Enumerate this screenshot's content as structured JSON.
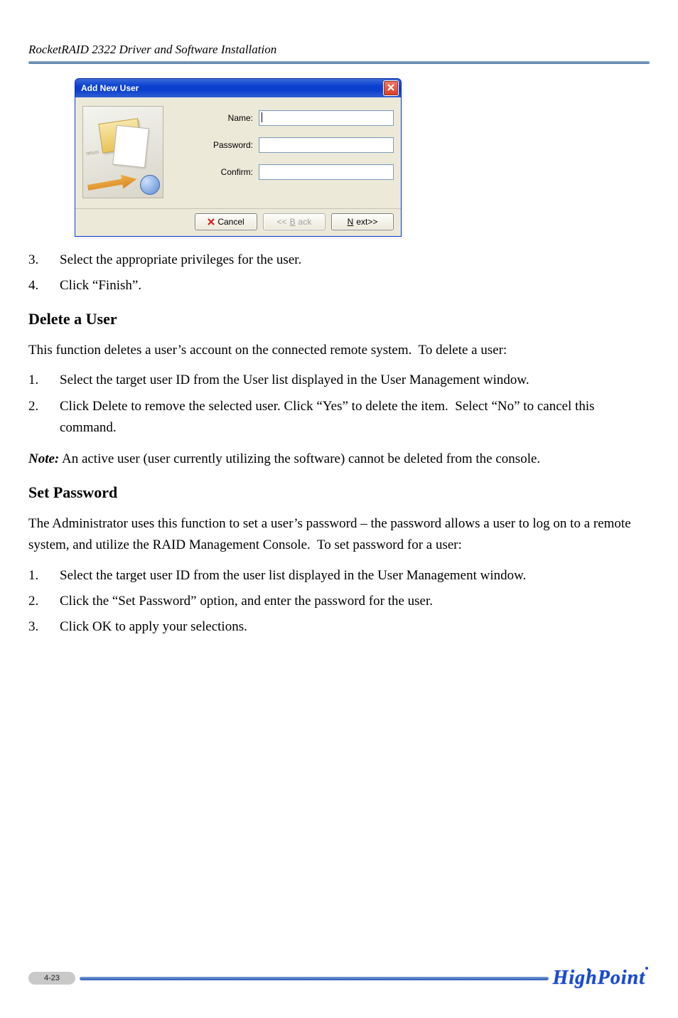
{
  "header": {
    "title": "RocketRAID 2322 Driver and Software Installation"
  },
  "dialog": {
    "title": "Add New User",
    "watermark": "return",
    "fields": {
      "name_label": "Name:",
      "password_label": "Password:",
      "confirm_label": "Confirm:"
    },
    "buttons": {
      "cancel": "Cancel",
      "back_prefix": "<<",
      "back_u": "B",
      "back_suffix": "ack",
      "next_u": "N",
      "next_suffix": "ext>>"
    }
  },
  "listA": [
    {
      "num": "3.",
      "text": "Select the appropriate privileges for the user."
    },
    {
      "num": "4.",
      "text": "Click “Finish”."
    }
  ],
  "sections": {
    "delete_heading": "Delete a User",
    "delete_intro": "This function deletes a user’s account on the connected remote system.  To delete a user:",
    "delete_steps": [
      {
        "num": "1.",
        "text": "Select the target user ID from the User list displayed in the User Management window."
      },
      {
        "num": "2.",
        "text": "Click Delete to remove the selected user. Click “Yes” to delete the item.  Select “No” to cancel this command."
      }
    ],
    "note_label": "Note:",
    "note_text": " An active user (user currently utilizing the software) cannot be deleted from the console.",
    "setpw_heading": "Set Password",
    "setpw_intro": "The Administrator uses this function to set a user’s password – the password allows a user to log on to a remote system, and utilize the RAID Management Console.  To set password for a user:",
    "setpw_steps": [
      {
        "num": "1.",
        "text": "Select the target user ID from the user list displayed in the User Management window."
      },
      {
        "num": "2.",
        "text": "Click the “Set Password” option, and enter the password for the user."
      },
      {
        "num": "3.",
        "text": "Click OK to apply your selections."
      }
    ]
  },
  "footer": {
    "page": "4-23",
    "brand": "HighPoint"
  }
}
